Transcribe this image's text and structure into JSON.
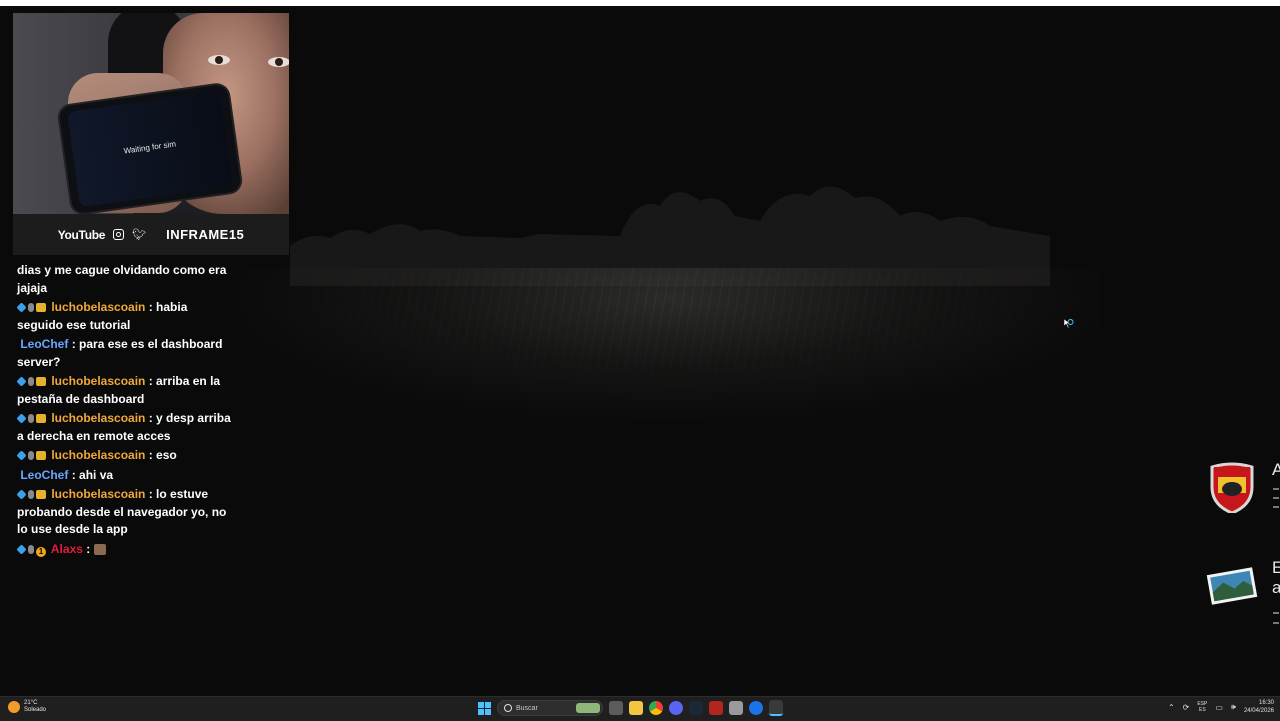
{
  "webcam": {
    "phone_text": "Waiting for sim",
    "social_youtube": "YouTube",
    "brand": "INFRAME15"
  },
  "chat": {
    "messages": [
      {
        "text": "dias y me cague olvidando como era jajaja"
      },
      {
        "user": "luchobelascoain",
        "text": ": habia seguido ese tutorial"
      },
      {
        "user": "LeoChef",
        "text": ": para ese es el dashboard server?"
      },
      {
        "user": "luchobelascoain",
        "text": ": arriba en la pestaña de dashboard"
      },
      {
        "user": "luchobelascoain",
        "text": ": y desp arriba a derecha en remote acces"
      },
      {
        "user": "luchobelascoain",
        "text": ": eso"
      },
      {
        "user": "LeoChef",
        "text": ": ahi va"
      },
      {
        "user": "luchobelascoain",
        "text": ": lo estuve probando desde el navegador yo, no lo use desde la app"
      },
      {
        "user": "Alaxs",
        "text": ":",
        "badge_number": "1"
      }
    ]
  },
  "widgets": {
    "letter_1": "A",
    "letter_2": "E",
    "letter_3": "a"
  },
  "taskbar": {
    "temperature": "21°C",
    "condition": "Soleado",
    "search_placeholder": "Buscar",
    "lang_1": "ESP",
    "lang_2": "ES",
    "time": "16:30",
    "date": "24/04/2026"
  },
  "colors": {
    "user_orange": "#f0a83c",
    "user_blue": "#6aa7ff",
    "user_red": "#e01c3c",
    "accent": "#4cc2ff"
  }
}
